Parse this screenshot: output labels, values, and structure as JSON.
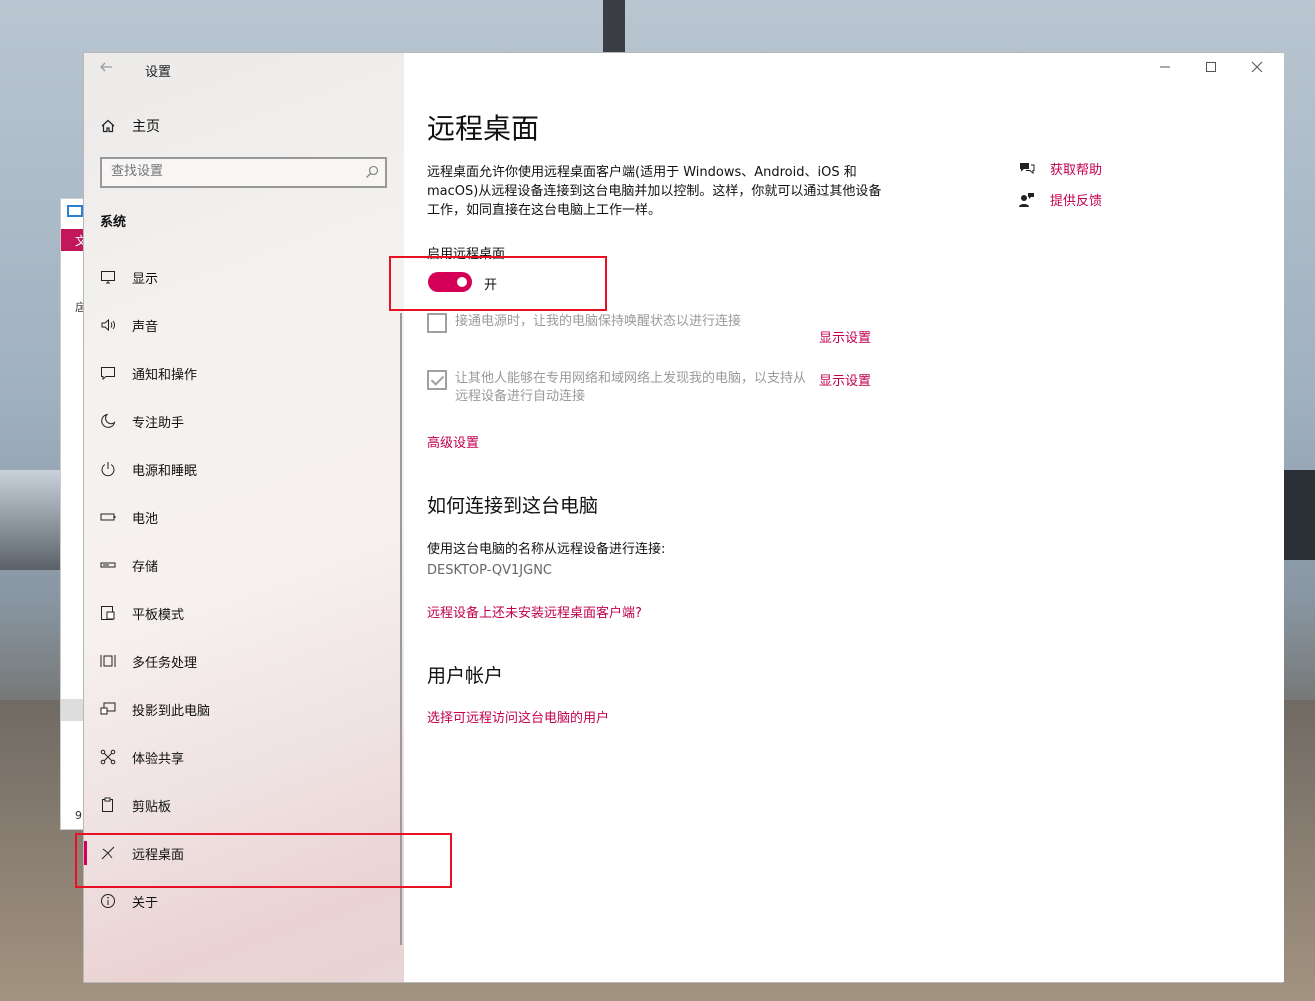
{
  "window": {
    "title": "设置"
  },
  "sidebar": {
    "home_label": "主页",
    "search_placeholder": "查找设置",
    "section_label": "系统",
    "items": [
      {
        "label": "显示",
        "icon": "monitor-icon"
      },
      {
        "label": "声音",
        "icon": "speaker-icon"
      },
      {
        "label": "通知和操作",
        "icon": "notification-icon"
      },
      {
        "label": "专注助手",
        "icon": "moon-icon"
      },
      {
        "label": "电源和睡眠",
        "icon": "power-icon"
      },
      {
        "label": "电池",
        "icon": "battery-icon"
      },
      {
        "label": "存储",
        "icon": "storage-icon"
      },
      {
        "label": "平板模式",
        "icon": "tablet-icon"
      },
      {
        "label": "多任务处理",
        "icon": "multitask-icon"
      },
      {
        "label": "投影到此电脑",
        "icon": "project-icon"
      },
      {
        "label": "体验共享",
        "icon": "share-icon"
      },
      {
        "label": "剪贴板",
        "icon": "clipboard-icon"
      },
      {
        "label": "远程桌面",
        "icon": "remote-desktop-icon",
        "active": true
      },
      {
        "label": "关于",
        "icon": "info-icon"
      }
    ]
  },
  "content": {
    "title": "远程桌面",
    "description": "远程桌面允许你使用远程桌面客户端(适用于 Windows、Android、iOS 和 macOS)从远程设备连接到这台电脑并加以控制。这样，你就可以通过其他设备工作，如同直接在这台电脑上工作一样。",
    "enable_label": "启用远程桌面",
    "toggle_state": "开",
    "toggle_on": true,
    "option1_text": "接通电源时，让我的电脑保持唤醒状态以进行连接",
    "option1_link": "显示设置",
    "option2_text": "让其他人能够在专用网络和域网络上发现我的电脑，以支持从远程设备进行自动连接",
    "option2_link": "显示设置",
    "advanced_link": "高级设置",
    "how_heading": "如何连接到这台电脑",
    "how_text": "使用这台电脑的名称从远程设备进行连接:",
    "pc_name": "DESKTOP-QV1JGNC",
    "client_link": "远程设备上还未安装远程桌面客户端?",
    "user_heading": "用户帐户",
    "user_link": "选择可远程访问这台电脑的用户"
  },
  "help": {
    "get_help": "获取帮助",
    "feedback": "提供反馈"
  },
  "behind_window": {
    "tab_text": "文",
    "text1": "扂",
    "text2": "9"
  },
  "colors": {
    "accent": "#d40057",
    "link": "#c2004e",
    "highlight_box": "#e81123"
  }
}
